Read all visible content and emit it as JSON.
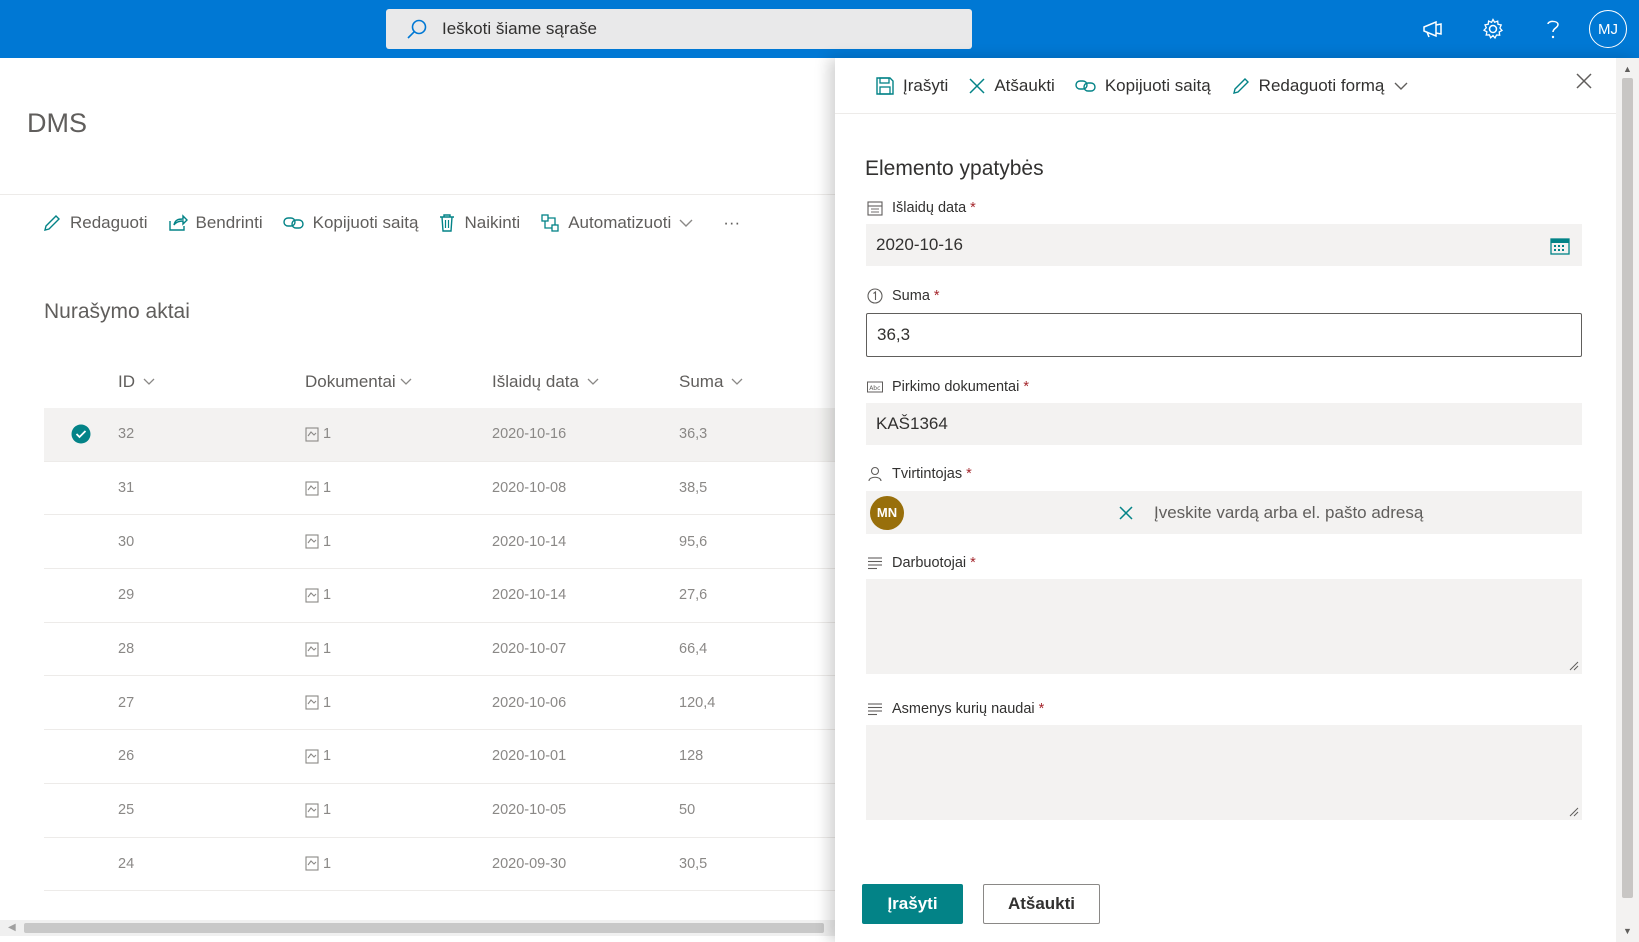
{
  "search": {
    "placeholder": "Ieškoti šiame sąraše"
  },
  "user": {
    "initials": "MJ"
  },
  "site": {
    "title": "DMS"
  },
  "commandbar": {
    "edit": "Redaguoti",
    "share": "Bendrinti",
    "copy_link": "Kopijuoti saitą",
    "delete": "Naikinti",
    "automate": "Automatizuoti",
    "more": "···"
  },
  "list": {
    "title": "Nurašymo aktai",
    "columns": {
      "id": "ID",
      "docs": "Dokumentai",
      "date": "Išlaidų data",
      "sum": "Suma"
    },
    "rows": [
      {
        "id": "32",
        "docs": "1",
        "date": "2020-10-16",
        "sum": "36,3"
      },
      {
        "id": "31",
        "docs": "1",
        "date": "2020-10-08",
        "sum": "38,5"
      },
      {
        "id": "30",
        "docs": "1",
        "date": "2020-10-14",
        "sum": "95,6"
      },
      {
        "id": "29",
        "docs": "1",
        "date": "2020-10-14",
        "sum": "27,6"
      },
      {
        "id": "28",
        "docs": "1",
        "date": "2020-10-07",
        "sum": "66,4"
      },
      {
        "id": "27",
        "docs": "1",
        "date": "2020-10-06",
        "sum": "120,4"
      },
      {
        "id": "26",
        "docs": "1",
        "date": "2020-10-01",
        "sum": "128"
      },
      {
        "id": "25",
        "docs": "1",
        "date": "2020-10-05",
        "sum": "50"
      },
      {
        "id": "24",
        "docs": "1",
        "date": "2020-09-30",
        "sum": "30,5"
      }
    ]
  },
  "panel": {
    "toolbar": {
      "save": "Įrašyti",
      "cancel": "Atšaukti",
      "copy_link": "Kopijuoti saitą",
      "edit_form": "Redaguoti formą"
    },
    "title": "Elemento ypatybės",
    "fields": {
      "date": {
        "label": "Išlaidų data",
        "value": "2020-10-16"
      },
      "sum": {
        "label": "Suma",
        "value": "36,3"
      },
      "docs": {
        "label": "Pirkimo dokumentai",
        "value": "KAŠ1364"
      },
      "approver": {
        "label": "Tvirtintojas",
        "initials": "MN",
        "placeholder": "Įveskite vardą arba el. pašto adresą"
      },
      "employees": {
        "label": "Darbuotojai"
      },
      "beneficiaries": {
        "label": "Asmenys kurių naudai"
      }
    },
    "required_mark": "*",
    "buttons": {
      "save": "Įrašyti",
      "cancel": "Atšaukti"
    }
  },
  "colors": {
    "brand": "#0078d4",
    "accent": "#038387",
    "required": "#a4262c"
  }
}
